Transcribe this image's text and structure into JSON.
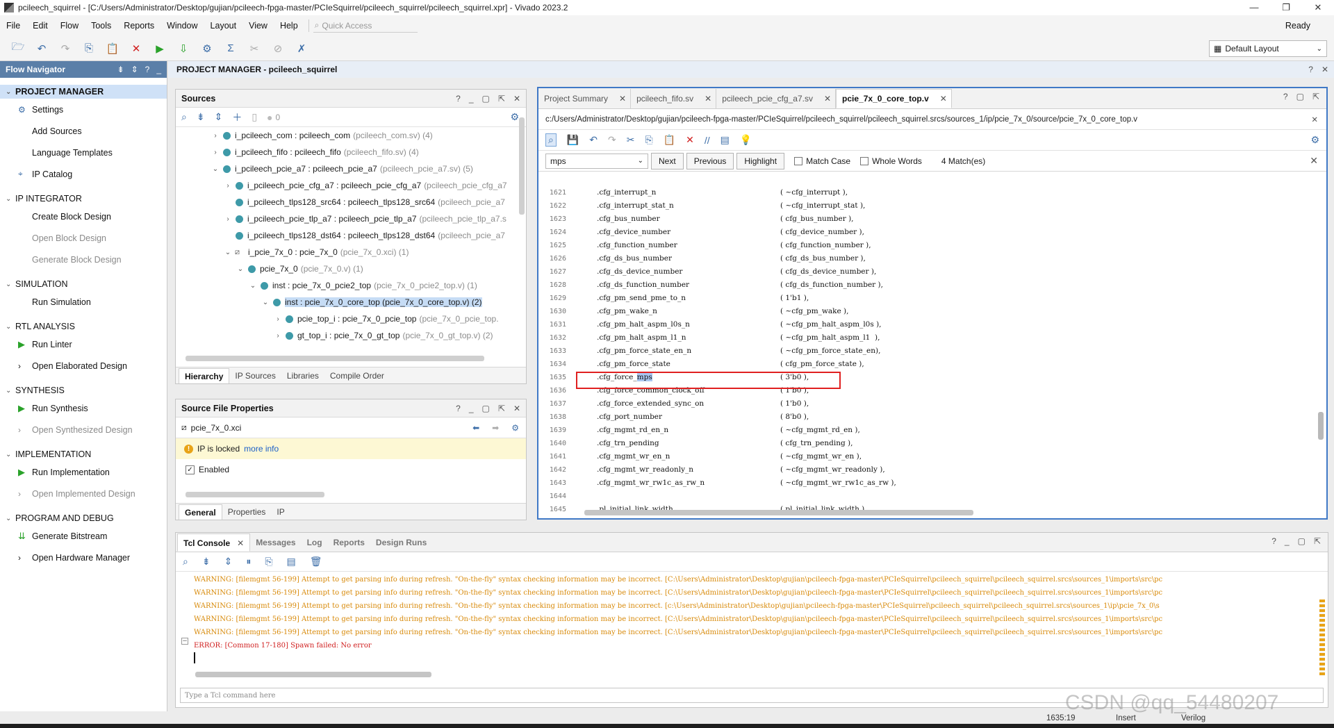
{
  "window": {
    "title": "pcileech_squirrel - [C:/Users/Administrator/Desktop/gujian/pcileech-fpga-master/PCIeSquirrel/pcileech_squirrel/pcileech_squirrel.xpr] - Vivado 2023.2",
    "controls": [
      "—",
      "❐",
      "✕"
    ]
  },
  "menubar": {
    "items": [
      "File",
      "Edit",
      "Flow",
      "Tools",
      "Reports",
      "Window",
      "Layout",
      "View",
      "Help"
    ],
    "quick_access_placeholder": "Quick Access",
    "status": "Ready"
  },
  "toolbar": {
    "layout_select": "Default Layout"
  },
  "flow_navigator": {
    "title": "Flow Navigator",
    "sections": [
      {
        "title": "PROJECT MANAGER",
        "active": true,
        "items": [
          {
            "label": "Settings",
            "icon": "gear-icon",
            "enabled": true
          },
          {
            "label": "Add Sources",
            "icon": "",
            "enabled": true
          },
          {
            "label": "Language Templates",
            "icon": "",
            "enabled": true
          },
          {
            "label": "IP Catalog",
            "icon": "ip-icon",
            "enabled": true
          }
        ]
      },
      {
        "title": "IP INTEGRATOR",
        "active": false,
        "items": [
          {
            "label": "Create Block Design",
            "icon": "",
            "enabled": true
          },
          {
            "label": "Open Block Design",
            "icon": "",
            "enabled": false
          },
          {
            "label": "Generate Block Design",
            "icon": "",
            "enabled": false
          }
        ]
      },
      {
        "title": "SIMULATION",
        "active": false,
        "items": [
          {
            "label": "Run Simulation",
            "icon": "",
            "enabled": true
          }
        ]
      },
      {
        "title": "RTL ANALYSIS",
        "active": false,
        "items": [
          {
            "label": "Run Linter",
            "icon": "play-icon",
            "enabled": true
          },
          {
            "label": "Open Elaborated Design",
            "icon": "chevron-right-icon",
            "enabled": true
          }
        ]
      },
      {
        "title": "SYNTHESIS",
        "active": false,
        "items": [
          {
            "label": "Run Synthesis",
            "icon": "play-icon",
            "enabled": true
          },
          {
            "label": "Open Synthesized Design",
            "icon": "chevron-right-icon",
            "enabled": false
          }
        ]
      },
      {
        "title": "IMPLEMENTATION",
        "active": false,
        "items": [
          {
            "label": "Run Implementation",
            "icon": "play-icon",
            "enabled": true
          },
          {
            "label": "Open Implemented Design",
            "icon": "chevron-right-icon",
            "enabled": false
          }
        ]
      },
      {
        "title": "PROGRAM AND DEBUG",
        "active": false,
        "items": [
          {
            "label": "Generate Bitstream",
            "icon": "bitstream-icon",
            "enabled": true
          },
          {
            "label": "Open Hardware Manager",
            "icon": "chevron-right-icon",
            "enabled": true
          }
        ]
      }
    ]
  },
  "project_manager_header": "PROJECT MANAGER - pcileech_squirrel",
  "sources": {
    "title": "Sources",
    "count": "0",
    "rows": [
      {
        "indent": 0,
        "chev": "›",
        "icon": "dot",
        "name": "i_pcileech_com : pcileech_com",
        "dim": "(pcileech_com.sv) (4)",
        "selected": false
      },
      {
        "indent": 0,
        "chev": "›",
        "icon": "dot",
        "name": "i_pcileech_fifo : pcileech_fifo",
        "dim": "(pcileech_fifo.sv) (4)",
        "selected": false
      },
      {
        "indent": 0,
        "chev": "⌄",
        "icon": "dot",
        "name": "i_pcileech_pcie_a7 : pcileech_pcie_a7",
        "dim": "(pcileech_pcie_a7.sv) (5)",
        "selected": false
      },
      {
        "indent": 1,
        "chev": "›",
        "icon": "dot",
        "name": "i_pcileech_pcie_cfg_a7 : pcileech_pcie_cfg_a7",
        "dim": "(pcileech_pcie_cfg_a7",
        "selected": false
      },
      {
        "indent": 1,
        "chev": "",
        "icon": "dot",
        "name": "i_pcileech_tlps128_src64 : pcileech_tlps128_src64",
        "dim": "(pcileech_pcie_a7",
        "selected": false
      },
      {
        "indent": 1,
        "chev": "›",
        "icon": "dot",
        "name": "i_pcileech_pcie_tlp_a7 : pcileech_pcie_tlp_a7",
        "dim": "(pcileech_pcie_tlp_a7.s",
        "selected": false
      },
      {
        "indent": 1,
        "chev": "",
        "icon": "dot",
        "name": "i_pcileech_tlps128_dst64 : pcileech_tlps128_dst64",
        "dim": "(pcileech_pcie_a7",
        "selected": false
      },
      {
        "indent": 1,
        "chev": "⌄",
        "icon": "lock",
        "name": "i_pcie_7x_0 : pcie_7x_0",
        "dim": "(pcie_7x_0.xci) (1)",
        "selected": false
      },
      {
        "indent": 2,
        "chev": "⌄",
        "icon": "dot",
        "name": "pcie_7x_0",
        "dim": "(pcie_7x_0.v) (1)",
        "selected": false
      },
      {
        "indent": 3,
        "chev": "⌄",
        "icon": "dot",
        "name": "inst : pcie_7x_0_pcie2_top",
        "dim": "(pcie_7x_0_pcie2_top.v) (1)",
        "selected": false
      },
      {
        "indent": 4,
        "chev": "⌄",
        "icon": "dot",
        "name": "inst : pcie_7x_0_core_top (pcie_7x_0_core_top.v) (2)",
        "dim": "",
        "selected": true
      },
      {
        "indent": 5,
        "chev": "›",
        "icon": "dot",
        "name": "pcie_top_i : pcie_7x_0_pcie_top",
        "dim": "(pcie_7x_0_pcie_top.",
        "selected": false
      },
      {
        "indent": 5,
        "chev": "›",
        "icon": "dot",
        "name": "gt_top_i : pcie_7x_0_gt_top",
        "dim": "(pcie_7x_0_gt_top.v) (2)",
        "selected": false
      }
    ],
    "tabs": [
      "Hierarchy",
      "IP Sources",
      "Libraries",
      "Compile Order"
    ]
  },
  "properties": {
    "title": "Source File Properties",
    "file": "pcie_7x_0.xci",
    "locked_text": "IP is locked",
    "more_info": "more info",
    "enabled_label": "Enabled",
    "tabs": [
      "General",
      "Properties",
      "IP"
    ]
  },
  "editor": {
    "tabs": [
      {
        "label": "Project Summary",
        "selected": false
      },
      {
        "label": "pcileech_fifo.sv",
        "selected": false
      },
      {
        "label": "pcileech_pcie_cfg_a7.sv",
        "selected": false
      },
      {
        "label": "pcie_7x_0_core_top.v",
        "selected": true
      }
    ],
    "path": "c:/Users/Administrator/Desktop/gujian/pcileech-fpga-master/PCIeSquirrel/pcileech_squirrel/pcileech_squirrel.srcs/sources_1/ip/pcie_7x_0/source/pcie_7x_0_core_top.v",
    "find": {
      "query": "mps",
      "next": "Next",
      "previous": "Previous",
      "highlight": "Highlight",
      "match_case": "Match Case",
      "whole_words": "Whole Words",
      "matches": "4 Match(es)"
    },
    "lines": [
      {
        "n": "1621",
        "port": ".cfg_interrupt_n",
        "sig": "( ~cfg_interrupt ),"
      },
      {
        "n": "1622",
        "port": ".cfg_interrupt_stat_n",
        "sig": "( ~cfg_interrupt_stat ),"
      },
      {
        "n": "1623",
        "port": ".cfg_bus_number",
        "sig": "( cfg_bus_number ),"
      },
      {
        "n": "1624",
        "port": ".cfg_device_number",
        "sig": "( cfg_device_number ),"
      },
      {
        "n": "1625",
        "port": ".cfg_function_number",
        "sig": "( cfg_function_number ),"
      },
      {
        "n": "1626",
        "port": ".cfg_ds_bus_number",
        "sig": "( cfg_ds_bus_number ),"
      },
      {
        "n": "1627",
        "port": ".cfg_ds_device_number",
        "sig": "( cfg_ds_device_number ),"
      },
      {
        "n": "1628",
        "port": ".cfg_ds_function_number",
        "sig": "( cfg_ds_function_number ),"
      },
      {
        "n": "1629",
        "port": ".cfg_pm_send_pme_to_n",
        "sig": "( 1'b1 ),"
      },
      {
        "n": "1630",
        "port": ".cfg_pm_wake_n",
        "sig": "( ~cfg_pm_wake ),"
      },
      {
        "n": "1631",
        "port": ".cfg_pm_halt_aspm_l0s_n",
        "sig": "( ~cfg_pm_halt_aspm_l0s ),"
      },
      {
        "n": "1632",
        "port": ".cfg_pm_halt_aspm_l1_n",
        "sig": "( ~cfg_pm_halt_aspm_l1  ),"
      },
      {
        "n": "1633",
        "port": ".cfg_pm_force_state_en_n",
        "sig": "( ~cfg_pm_force_state_en),"
      },
      {
        "n": "1634",
        "port": ".cfg_pm_force_state",
        "sig": "( cfg_pm_force_state ),"
      },
      {
        "n": "1635",
        "port": ".cfg_force_mps",
        "sig": "( 3'b0 ),"
      },
      {
        "n": "1636",
        "port": ".cfg_force_common_clock_off",
        "sig": "( 1'b0 ),"
      },
      {
        "n": "1637",
        "port": ".cfg_force_extended_sync_on",
        "sig": "( 1'b0 ),"
      },
      {
        "n": "1638",
        "port": ".cfg_port_number",
        "sig": "( 8'b0 ),"
      },
      {
        "n": "1639",
        "port": ".cfg_mgmt_rd_en_n",
        "sig": "( ~cfg_mgmt_rd_en ),"
      },
      {
        "n": "1640",
        "port": ".cfg_trn_pending",
        "sig": "( cfg_trn_pending ),"
      },
      {
        "n": "1641",
        "port": ".cfg_mgmt_wr_en_n",
        "sig": "( ~cfg_mgmt_wr_en ),"
      },
      {
        "n": "1642",
        "port": ".cfg_mgmt_wr_readonly_n",
        "sig": "( ~cfg_mgmt_wr_readonly ),"
      },
      {
        "n": "1643",
        "port": ".cfg_mgmt_wr_rw1c_as_rw_n",
        "sig": "( ~cfg_mgmt_wr_rw1c_as_rw ),"
      },
      {
        "n": "1644",
        "port": "",
        "sig": ""
      },
      {
        "n": "1645",
        "port": ".pl_initial_link_width",
        "sig": "( pl_initial_link_width ),"
      }
    ]
  },
  "console": {
    "tabs": [
      "Tcl Console",
      "Messages",
      "Log",
      "Reports",
      "Design Runs"
    ],
    "warnings": [
      "WARNING: [filemgmt 56-199] Attempt to get parsing info during refresh. \"On-the-fly\" syntax checking information may be incorrect. [C:\\Users\\Administrator\\Desktop\\gujian\\pcileech-fpga-master\\PCIeSquirrel\\pcileech_squirrel\\pcileech_squirrel.srcs\\sources_1\\imports\\src\\pc",
      "WARNING: [filemgmt 56-199] Attempt to get parsing info during refresh. \"On-the-fly\" syntax checking information may be incorrect. [C:\\Users\\Administrator\\Desktop\\gujian\\pcileech-fpga-master\\PCIeSquirrel\\pcileech_squirrel\\pcileech_squirrel.srcs\\sources_1\\imports\\src\\pc",
      "WARNING: [filemgmt 56-199] Attempt to get parsing info during refresh. \"On-the-fly\" syntax checking information may be incorrect. [c:\\Users\\Administrator\\Desktop\\gujian\\pcileech-fpga-master\\PCIeSquirrel\\pcileech_squirrel\\pcileech_squirrel.srcs\\sources_1\\ip\\pcie_7x_0\\s",
      "WARNING: [filemgmt 56-199] Attempt to get parsing info during refresh. \"On-the-fly\" syntax checking information may be incorrect. [C:\\Users\\Administrator\\Desktop\\gujian\\pcileech-fpga-master\\PCIeSquirrel\\pcileech_squirrel\\pcileech_squirrel.srcs\\sources_1\\imports\\src\\pc",
      "WARNING: [filemgmt 56-199] Attempt to get parsing info during refresh. \"On-the-fly\" syntax checking information may be incorrect. [C:\\Users\\Administrator\\Desktop\\gujian\\pcileech-fpga-master\\PCIeSquirrel\\pcileech_squirrel\\pcileech_squirrel.srcs\\sources_1\\imports\\src\\pc"
    ],
    "error": "ERROR: [Common 17-180] Spawn failed: No error",
    "command_placeholder": "Type a Tcl command here"
  },
  "statusbar": {
    "position": "1635:19",
    "mode": "Insert",
    "language": "Verilog"
  },
  "watermark": "CSDN @qq_54480207",
  "colors": {
    "accent": "#3f78c6",
    "flow_nav_header": "#5b7fa8",
    "warning": "#d88a0a",
    "error": "#d01f1f",
    "highlight_box": "#e02020"
  }
}
